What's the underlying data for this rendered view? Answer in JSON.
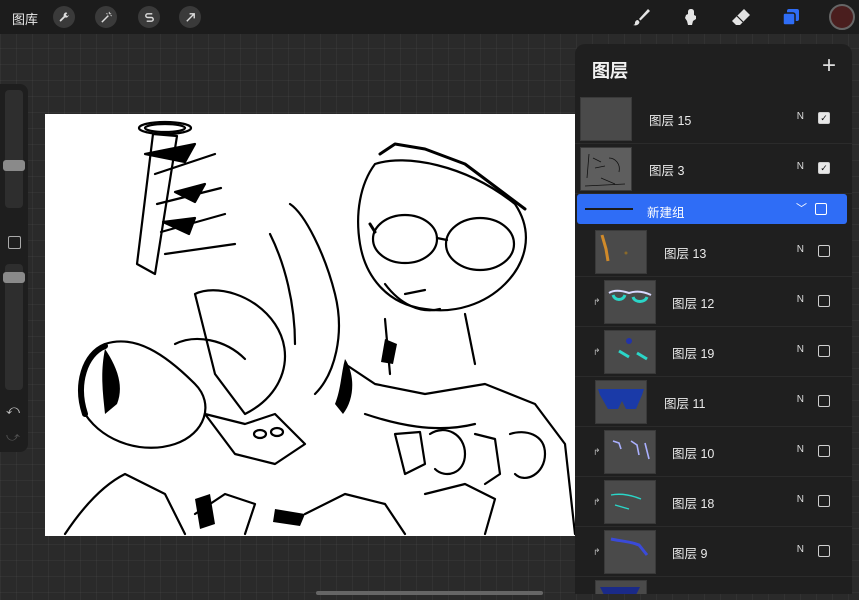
{
  "toolbar": {
    "gallery_label": "图库",
    "left_icons": [
      "wrench-icon",
      "magic-wand-icon",
      "selection-icon",
      "transform-arrow-icon"
    ],
    "right_icons": [
      "brush-icon",
      "smudge-icon",
      "eraser-icon",
      "layers-icon"
    ],
    "active_color": "#4a1e1e",
    "accent": "#2f6df6"
  },
  "sidebar": {
    "undo_icon": "undo-icon",
    "redo_icon": "redo-icon"
  },
  "layers": {
    "title": "图层",
    "add_icon": "plus-icon",
    "items": [
      {
        "name": "图层 15",
        "blend": "N",
        "visible": true
      },
      {
        "name": "图层 3",
        "blend": "N",
        "visible": true
      },
      {
        "name": "新建组",
        "type": "group",
        "visible": false
      },
      {
        "name": "图层 13",
        "blend": "N",
        "visible": false
      },
      {
        "name": "图层 12",
        "blend": "N",
        "visible": false,
        "clipped": true
      },
      {
        "name": "图层 19",
        "blend": "N",
        "visible": false,
        "clipped": true
      },
      {
        "name": "图层 11",
        "blend": "N",
        "visible": false
      },
      {
        "name": "图层 10",
        "blend": "N",
        "visible": false,
        "clipped": true
      },
      {
        "name": "图层 18",
        "blend": "N",
        "visible": false,
        "clipped": true
      },
      {
        "name": "图层 9",
        "blend": "N",
        "visible": false,
        "clipped": true
      }
    ]
  }
}
